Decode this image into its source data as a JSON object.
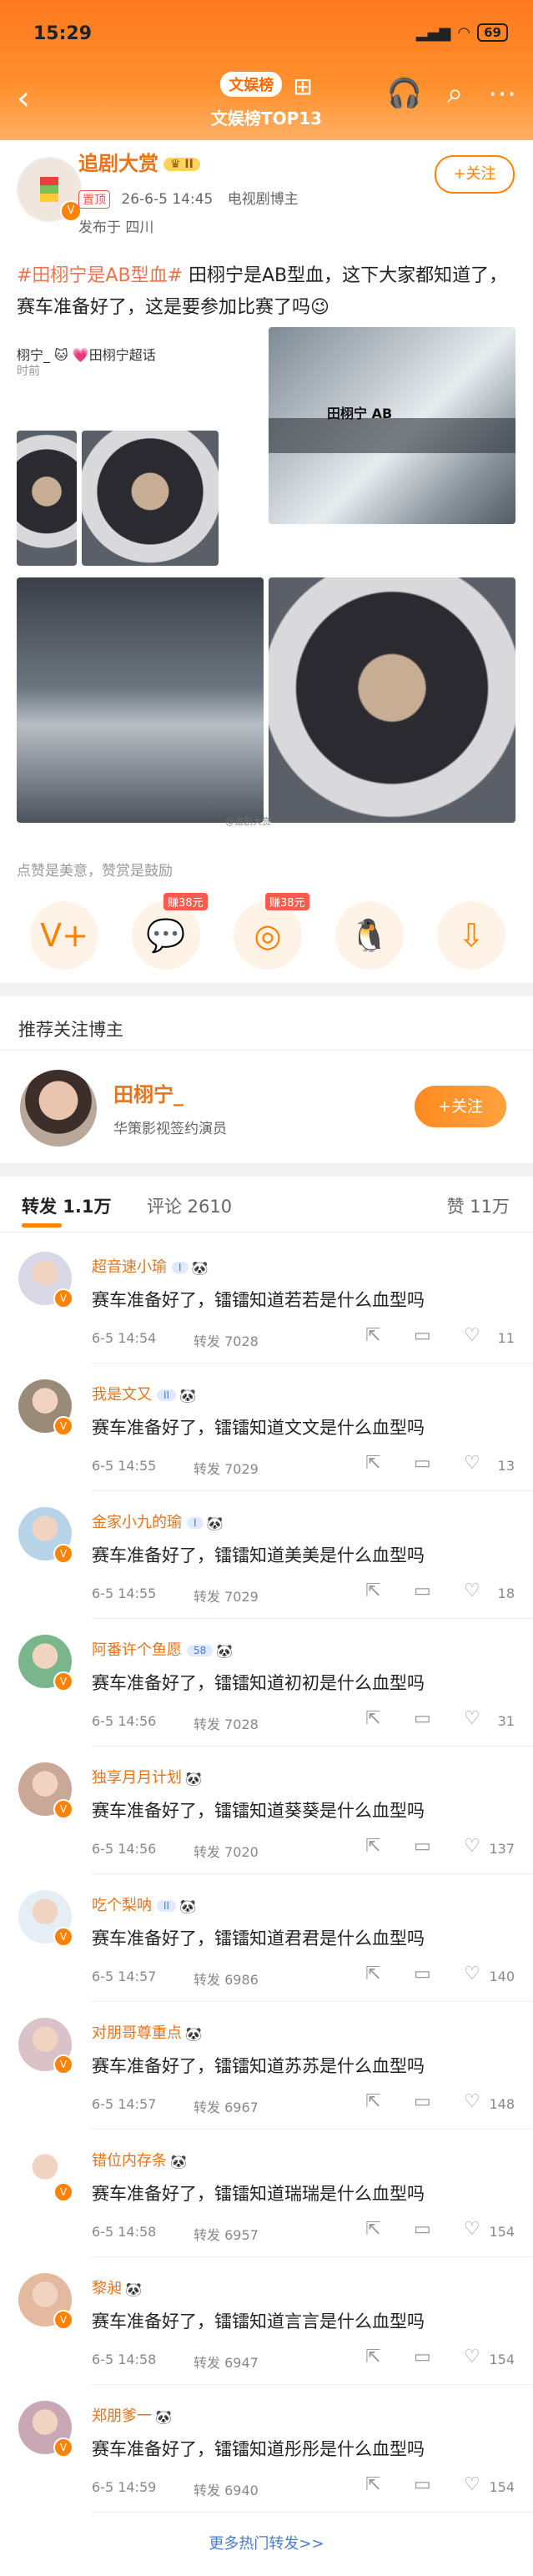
{
  "status_bar": {
    "time": "15:29",
    "battery": "69"
  },
  "nav": {
    "badge": "文娱榜",
    "subtitle": "文娱榜TOP13"
  },
  "post": {
    "author": "追剧大赏",
    "pin_label": "置顶",
    "date": "26-6-5 14:45",
    "source": "电视剧博主",
    "location": "发布于 四川",
    "follow_label": "+关注",
    "hashtag": "#田栩宁是AB型血#",
    "text": " 田栩宁是AB型血，这下大家都知道了，赛车准备好了，这是要参加比赛了吗😉",
    "repost_user": "栩宁_ 🐱 💗田栩宁超话",
    "repost_time": "时前",
    "car_text": "田栩宁 AB",
    "watermark": "@追剧大赏"
  },
  "reward": {
    "note": "点赞是美意，赞赏是鼓励",
    "items": [
      {
        "icon": "V+",
        "tag": ""
      },
      {
        "icon": "💬",
        "tag": "赚38元"
      },
      {
        "icon": "◎",
        "tag": "赚38元"
      },
      {
        "icon": "🐧",
        "tag": ""
      },
      {
        "icon": "⇩",
        "tag": ""
      }
    ]
  },
  "recommend": {
    "title": "推荐关注博主",
    "name": "田栩宁_",
    "desc": "华策影视签约演员",
    "follow_label": "+关注"
  },
  "tabs": {
    "repost": "转发 1.1万",
    "comment": "评论 2610",
    "like": "赞 11万"
  },
  "reposts": [
    {
      "user": "超音速小瑜",
      "level": "I",
      "text": "赛车准备好了，镭镭知道若若是什么血型吗",
      "time": "6-5 14:54",
      "count": "转发 7028",
      "likes": "11",
      "color": "#d8d8e6"
    },
    {
      "user": "我是文又",
      "level": "II",
      "text": "赛车准备好了，镭镭知道文文是什么血型吗",
      "time": "6-5 14:55",
      "count": "转发 7029",
      "likes": "13",
      "color": "#9a8a78"
    },
    {
      "user": "金家小九的瑜",
      "level": "I",
      "text": "赛车准备好了，镭镭知道美美是什么血型吗",
      "time": "6-5 14:55",
      "count": "转发 7029",
      "likes": "18",
      "color": "#b7d3e8"
    },
    {
      "user": "阿番许个鱼愿",
      "level": "58",
      "text": "赛车准备好了，镭镭知道初初是什么血型吗",
      "time": "6-5 14:56",
      "count": "转发 7028",
      "likes": "31",
      "color": "#7bb58c"
    },
    {
      "user": "独享月月计划",
      "level": "",
      "text": "赛车准备好了，镭镭知道葵葵是什么血型吗",
      "time": "6-5 14:56",
      "count": "转发 7020",
      "likes": "137",
      "color": "#c9a898"
    },
    {
      "user": "吃个梨呐",
      "level": "II",
      "text": "赛车准备好了，镭镭知道君君是什么血型吗",
      "time": "6-5 14:57",
      "count": "转发 6986",
      "likes": "140",
      "color": "#e5eef5"
    },
    {
      "user": "对朋哥尊重点",
      "level": "",
      "text": "赛车准备好了，镭镭知道苏苏是什么血型吗",
      "time": "6-5 14:57",
      "count": "转发 6967",
      "likes": "148",
      "color": "#d9c3c8"
    },
    {
      "user": "错位内存条",
      "level": "",
      "text": "赛车准备好了，镭镭知道瑞瑞是什么血型吗",
      "time": "6-5 14:58",
      "count": "转发 6957",
      "likes": "154",
      "color": "#ffffff"
    },
    {
      "user": "黎昶",
      "level": "",
      "text": "赛车准备好了，镭镭知道言言是什么血型吗",
      "time": "6-5 14:58",
      "count": "转发 6947",
      "likes": "154",
      "color": "#e3b9a0"
    },
    {
      "user": "郑朋爹一",
      "level": "",
      "text": "赛车准备好了，镭镭知道彤彤是什么血型吗",
      "time": "6-5 14:59",
      "count": "转发 6940",
      "likes": "154",
      "color": "#caa7b5"
    }
  ],
  "more_label": "更多热门转发>>"
}
